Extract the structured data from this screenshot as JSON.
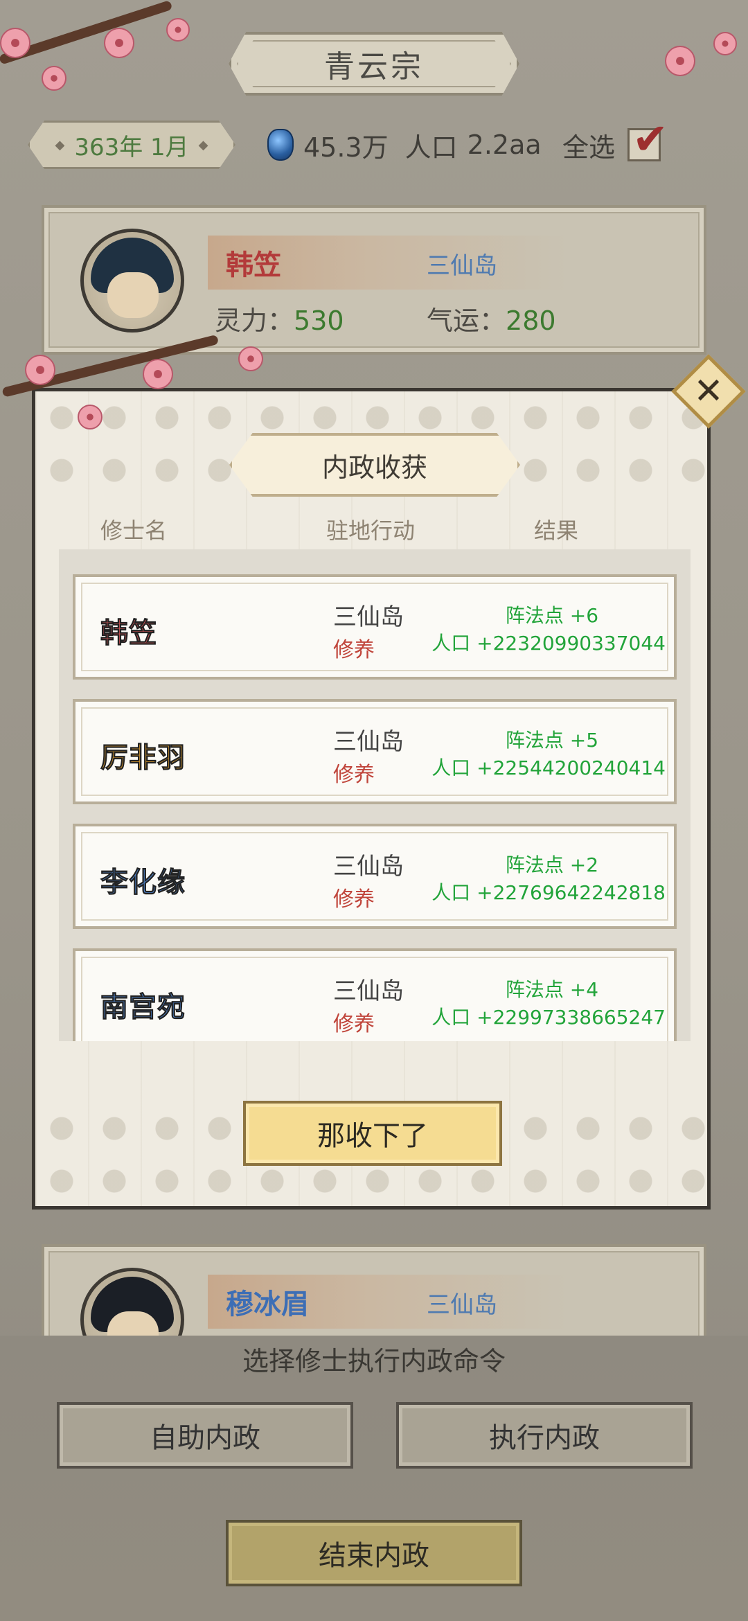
{
  "header": {
    "title": "青云宗",
    "date": "363年 1月",
    "spirit_stones": "45.3万",
    "population_label": "人口",
    "population": "2.2aa",
    "select_all_label": "全选",
    "select_all_checked": true
  },
  "background_cards": [
    {
      "name": "韩笠",
      "name_color": "#c23b3b",
      "location": "三仙岛",
      "spirit_label": "灵力：",
      "spirit": "530",
      "luck_label": "气运：",
      "luck": "280"
    },
    {
      "name": "穆冰眉",
      "name_color": "#3d6eb5",
      "location": "三仙岛"
    }
  ],
  "modal": {
    "title": "内政收获",
    "columns": [
      "修士名",
      "驻地行动",
      "结果"
    ],
    "rows": [
      {
        "name": "韩笠",
        "name_color": "#e0585a",
        "location": "三仙岛",
        "action": "修养",
        "result_formation": "阵法点 +6",
        "result_population": "人口 +22320990337044"
      },
      {
        "name": "厉非羽",
        "name_color": "#d89a2f",
        "location": "三仙岛",
        "action": "修养",
        "result_formation": "阵法点 +5",
        "result_population": "人口 +22544200240414"
      },
      {
        "name": "李化缘",
        "name_color": "#4f86d0",
        "location": "三仙岛",
        "action": "修养",
        "result_formation": "阵法点 +2",
        "result_population": "人口 +22769642242818"
      },
      {
        "name": "南宫宛",
        "name_color": "#4f86d0",
        "location": "三仙岛",
        "action": "修养",
        "result_formation": "阵法点 +4",
        "result_population": "人口 +22997338665247"
      }
    ],
    "confirm_label": "那收下了",
    "close_icon": "close-icon"
  },
  "footer": {
    "hint": "选择修士执行内政命令",
    "auto_label": "自助内政",
    "execute_label": "执行内政",
    "end_label": "结束内政"
  },
  "colors": {
    "accent_gold": "#f5dc92",
    "result_green": "#22a43a",
    "action_red": "#c0443a"
  }
}
